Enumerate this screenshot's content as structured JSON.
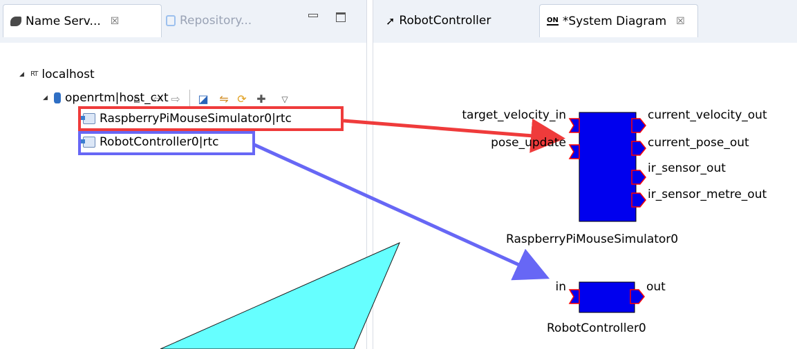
{
  "left_view": {
    "tabs": [
      {
        "label": "Name Serv...",
        "close": "☒"
      },
      {
        "label": "Repository..."
      }
    ],
    "tree": {
      "host": "localhost",
      "host_prefix": "RT",
      "naming_context": "openrtm|host_cxt",
      "components": [
        "RaspberryPiMouseSimulator0|rtc",
        "RobotController0|rtc"
      ]
    }
  },
  "editor": {
    "tabs": [
      {
        "label": "RobotController"
      },
      {
        "label": "*System Diagram",
        "close": "☒",
        "icon": "ON"
      }
    ]
  },
  "diagram": {
    "components": [
      {
        "name": "RaspberryPiMouseSimulator0",
        "inports": [
          "target_velocity_in",
          "pose_update"
        ],
        "outports": [
          "current_velocity_out",
          "current_pose_out",
          "ir_sensor_out",
          "ir_sensor_metre_out"
        ]
      },
      {
        "name": "RobotController0",
        "inports": [
          "in"
        ],
        "outports": [
          "out"
        ]
      }
    ]
  },
  "colors": {
    "component_fill": "#0000ee",
    "port_border": "#ff0000",
    "highlight_red": "#ef3b3b",
    "highlight_blue": "#6767f5",
    "cyan_triangle": "#66ffff"
  }
}
